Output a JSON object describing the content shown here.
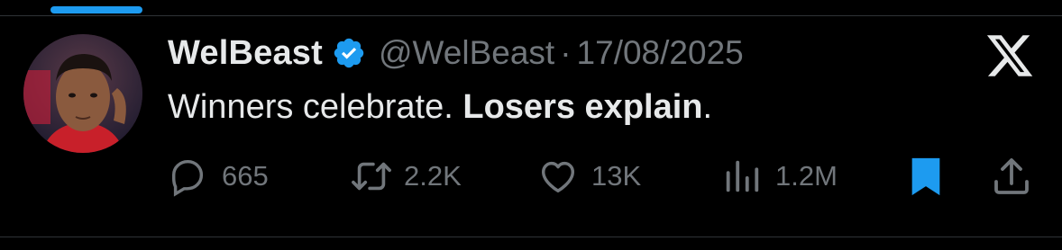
{
  "tab_indicator_color": "#1d9bf0",
  "avatar": {
    "description_icon": "avatar"
  },
  "tweet": {
    "display_name": "WelBeast",
    "verified": true,
    "handle": "@WelBeast",
    "separator": "·",
    "date": "17/08/2025",
    "text_plain": "Winners celebrate. ",
    "text_bold": "Losers explain",
    "text_end": "."
  },
  "platform_logo": "x-logo-icon",
  "actions": {
    "replies": {
      "icon": "reply-icon",
      "count": "665"
    },
    "reposts": {
      "icon": "repost-icon",
      "count": "2.2K"
    },
    "likes": {
      "icon": "like-icon",
      "count": "13K"
    },
    "views": {
      "icon": "views-icon",
      "count": "1.2M"
    },
    "bookmark": {
      "icon": "bookmark-icon",
      "state": "active",
      "color": "#1d9bf0"
    },
    "share": {
      "icon": "share-icon"
    }
  },
  "colors": {
    "background": "#000000",
    "primary_text": "#e7e9ea",
    "secondary_text": "#71767b",
    "accent": "#1d9bf0"
  }
}
